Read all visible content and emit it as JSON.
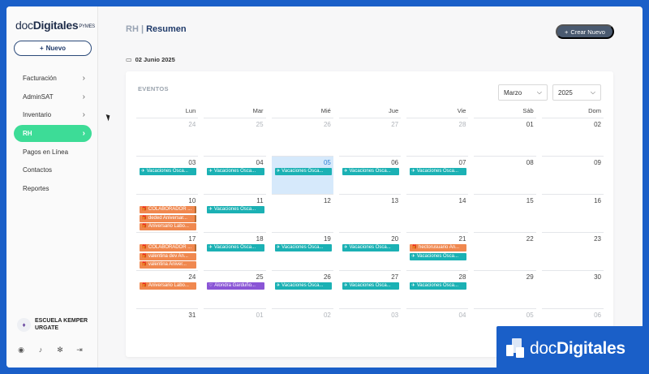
{
  "brand": {
    "doc": "doc",
    "digitales": "Digitales",
    "pymes": "PYMES"
  },
  "sidebar": {
    "new_button": "Nuevo",
    "items": [
      {
        "label": "Facturación",
        "chevron": true,
        "active": false
      },
      {
        "label": "AdminSAT",
        "chevron": true,
        "active": false
      },
      {
        "label": "Inventario",
        "chevron": true,
        "active": false
      },
      {
        "label": "RH",
        "chevron": true,
        "active": true
      },
      {
        "label": "Pagos en Línea",
        "chevron": false,
        "active": false
      },
      {
        "label": "Contactos",
        "chevron": false,
        "active": false
      },
      {
        "label": "Reportes",
        "chevron": false,
        "active": false
      }
    ],
    "org_name": "ESCUELA KEMPER URGATE"
  },
  "header": {
    "section": "RH",
    "separator": "|",
    "current": "Resumen",
    "create_button": "Crear Nuevo"
  },
  "date_label": "02 Junio 2025",
  "calendar": {
    "events_label": "EVENTOS",
    "month_select": "Marzo",
    "year_select": "2025",
    "weekdays": [
      "Lun",
      "Mar",
      "Mié",
      "Jue",
      "Vie",
      "Sáb",
      "Dom"
    ],
    "weeks": [
      [
        {
          "d": "24",
          "m": true,
          "ev": []
        },
        {
          "d": "25",
          "m": true,
          "ev": []
        },
        {
          "d": "26",
          "m": true,
          "ev": []
        },
        {
          "d": "27",
          "m": true,
          "ev": []
        },
        {
          "d": "28",
          "m": true,
          "ev": []
        },
        {
          "d": "01",
          "ev": []
        },
        {
          "d": "02",
          "ev": []
        }
      ],
      [
        {
          "d": "03",
          "ev": [
            {
              "t": "Vacaciones Osca...",
              "c": "teal"
            }
          ]
        },
        {
          "d": "04",
          "ev": [
            {
              "t": "Vacaciones Osca...",
              "c": "teal"
            }
          ]
        },
        {
          "d": "05",
          "today": true,
          "ev": [
            {
              "t": "Vacaciones Osca...",
              "c": "teal"
            }
          ]
        },
        {
          "d": "06",
          "ev": [
            {
              "t": "Vacaciones Osca...",
              "c": "teal"
            }
          ]
        },
        {
          "d": "07",
          "ev": [
            {
              "t": "Vacaciones Osca...",
              "c": "teal"
            }
          ]
        },
        {
          "d": "08",
          "ev": []
        },
        {
          "d": "09",
          "ev": []
        }
      ],
      [
        {
          "d": "10",
          "ev": [
            {
              "t": "COLABORADOR ...",
              "c": "orange",
              "bar": true
            },
            {
              "t": "deded Aniversar...",
              "c": "orange",
              "bar": true
            },
            {
              "t": "Aniversario Labo...",
              "c": "orange"
            }
          ]
        },
        {
          "d": "11",
          "ev": [
            {
              "t": "Vacaciones Osca...",
              "c": "teal"
            }
          ]
        },
        {
          "d": "12",
          "ev": []
        },
        {
          "d": "13",
          "ev": []
        },
        {
          "d": "14",
          "ev": []
        },
        {
          "d": "15",
          "ev": []
        },
        {
          "d": "16",
          "ev": []
        }
      ],
      [
        {
          "d": "17",
          "ev": [
            {
              "t": "COLABORADOR ...",
              "c": "orange",
              "bar": true
            },
            {
              "t": "valentina dev An...",
              "c": "orange"
            },
            {
              "t": "valentina Aniver...",
              "c": "orange"
            }
          ]
        },
        {
          "d": "18",
          "ev": [
            {
              "t": "Vacaciones Osca...",
              "c": "teal"
            }
          ]
        },
        {
          "d": "19",
          "ev": [
            {
              "t": "Vacaciones Osca...",
              "c": "teal"
            }
          ]
        },
        {
          "d": "20",
          "ev": [
            {
              "t": "Vacaciones Osca...",
              "c": "teal"
            }
          ]
        },
        {
          "d": "21",
          "ev": [
            {
              "t": "hectorusuario An...",
              "c": "orange"
            },
            {
              "t": "Vacaciones Osca...",
              "c": "teal"
            }
          ]
        },
        {
          "d": "22",
          "ev": []
        },
        {
          "d": "23",
          "ev": []
        }
      ],
      [
        {
          "d": "24",
          "ev": [
            {
              "t": "Aniversario Labo...",
              "c": "orange"
            }
          ]
        },
        {
          "d": "25",
          "ev": [
            {
              "t": "Alondra Garduño...",
              "c": "purple"
            }
          ]
        },
        {
          "d": "26",
          "ev": [
            {
              "t": "Vacaciones Osca...",
              "c": "teal"
            }
          ]
        },
        {
          "d": "27",
          "ev": [
            {
              "t": "Vacaciones Osca...",
              "c": "teal"
            }
          ]
        },
        {
          "d": "28",
          "ev": [
            {
              "t": "Vacaciones Osca...",
              "c": "teal"
            }
          ]
        },
        {
          "d": "29",
          "ev": []
        },
        {
          "d": "30",
          "ev": []
        }
      ],
      [
        {
          "d": "31",
          "ev": []
        },
        {
          "d": "01",
          "m": true,
          "ev": []
        },
        {
          "d": "02",
          "m": true,
          "ev": []
        },
        {
          "d": "03",
          "m": true,
          "ev": []
        },
        {
          "d": "04",
          "m": true,
          "ev": []
        },
        {
          "d": "05",
          "m": true,
          "ev": []
        },
        {
          "d": "06",
          "m": true,
          "ev": []
        }
      ]
    ]
  },
  "watermark": {
    "doc": "doc",
    "digitales": "Digitales"
  },
  "colors": {
    "accent": "#3ddc97",
    "teal": "#1bb1b4",
    "orange": "#f0884f",
    "purple": "#8a55d6",
    "brand_blue": "#1a5fc8"
  }
}
